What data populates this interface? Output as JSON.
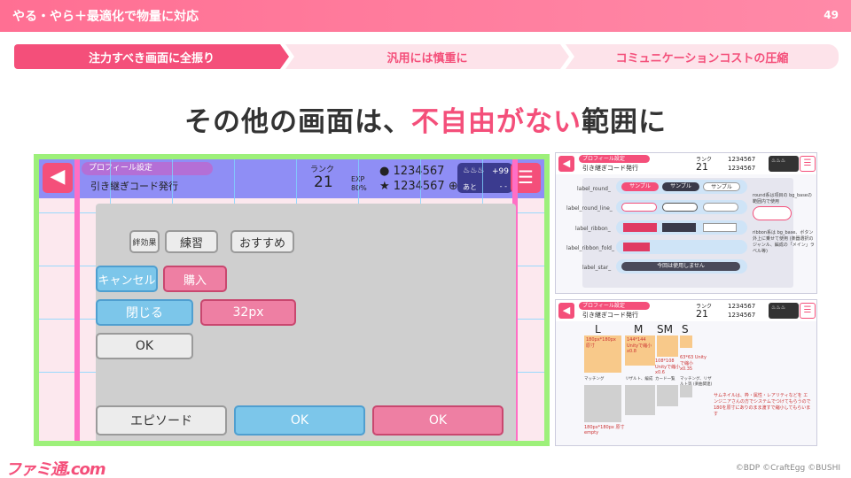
{
  "slide": {
    "title": "やる・やら＋最適化で物量に対応",
    "page_number": "49",
    "steps": [
      "注力すべき画面に全振り",
      "汎用には慎重に",
      "コミュニケーションコストの圧縮"
    ],
    "headline_prefix": "その他の画面は、",
    "headline_accent": "不自由がない",
    "headline_suffix": "範囲に",
    "logo": "ファミ通.com",
    "credit": "©BDP ©CraftEgg ©BUSHI"
  },
  "mock_main": {
    "back_icon": "back-arrow-icon",
    "menu_icon": "hamburger-menu-icon",
    "profile_tag": "プロフィール設定",
    "subtitle": "引き継ぎコード発行",
    "rank_label": "ランク",
    "rank_value": "21",
    "exp_label": "EXP",
    "exp_value": "80%",
    "coin_value_1": "1234567",
    "coin_value_2": "1234567",
    "lp_gain": "+99",
    "lp_label": "あと",
    "lp_time": "- -",
    "buttons": {
      "kizuna": "絆効果",
      "practice": "練習",
      "recommend": "おすすめ",
      "cancel": "キャンセル",
      "purchase": "購入",
      "close": "閉じる",
      "size32": "32px",
      "ok_small": "OK",
      "episode": "エピソード",
      "ok_blue": "OK",
      "ok_pink": "OK"
    }
  },
  "mock_right_top": {
    "profile_tag": "プロフィール設定",
    "subtitle": "引き継ぎコード発行",
    "rank_label": "ランク",
    "rank_value": "21",
    "coin_value": "1234567",
    "rows": [
      "label_round_",
      "label_round_line_",
      "label_ribbon_",
      "label_ribbon_fold_",
      "label_star_"
    ],
    "chips": [
      "サンプル",
      "サンプル",
      "サンプル"
    ],
    "star_text": "今回は使用しません",
    "note_round": "round系は項目の bg_baseの範囲内で使用",
    "note_ribbon": "ribbon系は bg_base、ボタン外上に乗せて使用 (楽器選択のジャンル、編成の「メイン」ラベル等)"
  },
  "mock_right_bottom": {
    "profile_tag": "プロフィール設定",
    "subtitle": "引き継ぎコード発行",
    "rank_label": "ランク",
    "rank_value": "21",
    "coin_value": "1234567",
    "sizes": [
      "L",
      "M",
      "SM",
      "S"
    ],
    "box_notes": [
      "180px*180px 原寸",
      "144*144 Unityで縮小 x0.8",
      "108*108 Unityで縮小 x0.6",
      "63*63 Unityで縮小 x0.35"
    ],
    "avatar_labels": [
      "マッチング",
      "リザルト、編成",
      "カード一覧",
      "マッチング、リザルト等 (楽曲関連)"
    ],
    "bottom_note": "180px*180px 原寸 empty",
    "right_note": "サムネイルは、枠・属性・レアリティなどを エンジニアさんの方でシステムでつけてもらうので 180を原寸にありのまま渡すで縮小してもらいます"
  }
}
